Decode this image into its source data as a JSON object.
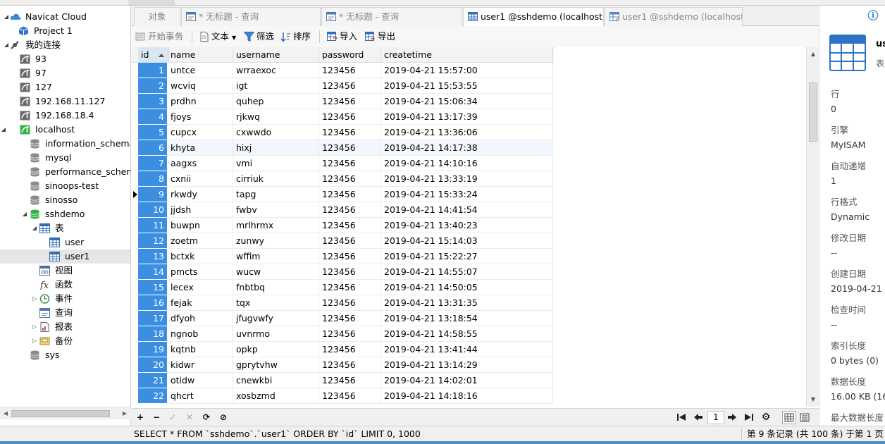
{
  "sidebar": {
    "items": [
      {
        "label": "Navicat Cloud",
        "icon": "cloud-icon",
        "arrow": "expanded"
      },
      {
        "label": "Project 1",
        "icon": "project-cube-icon",
        "arrow": ""
      },
      {
        "label": "我的连接",
        "icon": "connections-icon",
        "arrow": "expanded"
      },
      {
        "label": "93",
        "icon": "dolphin-connection-icon",
        "arrow": ""
      },
      {
        "label": "97",
        "icon": "dolphin-connection-icon",
        "arrow": ""
      },
      {
        "label": "127",
        "icon": "dolphin-connection-icon",
        "arrow": ""
      },
      {
        "label": "192.168.11.127",
        "icon": "dolphin-connection-icon",
        "arrow": ""
      },
      {
        "label": "192.168.18.4",
        "icon": "dolphin-connection-icon",
        "arrow": ""
      },
      {
        "label": "localhost",
        "icon": "dolphin-connection-active-icon",
        "arrow": "expanded"
      },
      {
        "label": "information_schema",
        "icon": "database-icon",
        "arrow": ""
      },
      {
        "label": "mysql",
        "icon": "database-icon",
        "arrow": ""
      },
      {
        "label": "performance_schema",
        "icon": "database-icon",
        "arrow": ""
      },
      {
        "label": "sinoops-test",
        "icon": "database-icon",
        "arrow": ""
      },
      {
        "label": "sinosso",
        "icon": "database-icon",
        "arrow": ""
      },
      {
        "label": "sshdemo",
        "icon": "database-open-icon",
        "arrow": "expanded"
      },
      {
        "label": "表",
        "icon": "tables-icon",
        "arrow": "expanded"
      },
      {
        "label": "user",
        "icon": "table-icon",
        "arrow": ""
      },
      {
        "label": "user1",
        "icon": "table-icon",
        "arrow": "",
        "selected": true
      },
      {
        "label": "视图",
        "icon": "view-icon",
        "arrow": ""
      },
      {
        "label": "函数",
        "icon": "function-icon",
        "arrow": ""
      },
      {
        "label": "事件",
        "icon": "event-clock-icon",
        "arrow": "collapsed"
      },
      {
        "label": "查询",
        "icon": "query-icon",
        "arrow": ""
      },
      {
        "label": "报表",
        "icon": "report-icon",
        "arrow": "collapsed"
      },
      {
        "label": "备份",
        "icon": "backup-icon",
        "arrow": "collapsed"
      },
      {
        "label": "sys",
        "icon": "database-icon",
        "arrow": ""
      }
    ]
  },
  "tabs": [
    {
      "label": "对象",
      "icon": ""
    },
    {
      "label": "* 无标题 - 查询",
      "icon": "query-tab-icon"
    },
    {
      "label": "* 无标题 - 查询",
      "icon": "query-tab-icon"
    },
    {
      "label": "user1 @sshdemo (localhost...",
      "icon": "table-tab-icon",
      "active": true
    },
    {
      "label": "user1 @sshdemo (localhost...",
      "icon": "table-design-tab-icon"
    }
  ],
  "toolbar": {
    "begin_transaction": "开始事务",
    "text": "文本",
    "filter": "筛选",
    "sort": "排序",
    "import": "导入",
    "export": "导出"
  },
  "grid": {
    "columns": [
      "id",
      "name",
      "username",
      "password",
      "createtime"
    ],
    "current_row": 9,
    "rows": [
      [
        "1",
        "untce",
        "wrraexoc",
        "123456",
        "2019-04-21 15:57:00"
      ],
      [
        "2",
        "wcviq",
        "igt",
        "123456",
        "2019-04-21 15:53:55"
      ],
      [
        "3",
        "prdhn",
        "quhep",
        "123456",
        "2019-04-21 15:06:34"
      ],
      [
        "4",
        "fjoys",
        "rjkwq",
        "123456",
        "2019-04-21 13:17:39"
      ],
      [
        "5",
        "cupcx",
        "cxwwdo",
        "123456",
        "2019-04-21 13:36:06"
      ],
      [
        "6",
        "khyta",
        "hixj",
        "123456",
        "2019-04-21 14:17:38"
      ],
      [
        "7",
        "aagxs",
        "vmi",
        "123456",
        "2019-04-21 14:10:16"
      ],
      [
        "8",
        "cxnii",
        "cirriuk",
        "123456",
        "2019-04-21 13:33:19"
      ],
      [
        "9",
        "rkwdy",
        "tapg",
        "123456",
        "2019-04-21 15:33:24"
      ],
      [
        "10",
        "jjdsh",
        "fwbv",
        "123456",
        "2019-04-21 14:41:54"
      ],
      [
        "11",
        "buwpn",
        "mrlhrmx",
        "123456",
        "2019-04-21 13:40:23"
      ],
      [
        "12",
        "zoetm",
        "zunwy",
        "123456",
        "2019-04-21 15:14:03"
      ],
      [
        "13",
        "bctxk",
        "wffim",
        "123456",
        "2019-04-21 15:22:27"
      ],
      [
        "14",
        "pmcts",
        "wucw",
        "123456",
        "2019-04-21 14:55:07"
      ],
      [
        "15",
        "lecex",
        "fnbtbq",
        "123456",
        "2019-04-21 14:50:05"
      ],
      [
        "16",
        "fejak",
        "tqx",
        "123456",
        "2019-04-21 13:31:35"
      ],
      [
        "17",
        "dfyoh",
        "jfugvwfy",
        "123456",
        "2019-04-21 13:18:54"
      ],
      [
        "18",
        "ngnob",
        "uvnrmo",
        "123456",
        "2019-04-21 14:58:55"
      ],
      [
        "19",
        "kqtnb",
        "opkp",
        "123456",
        "2019-04-21 13:41:44"
      ],
      [
        "20",
        "kidwr",
        "gprytvhw",
        "123456",
        "2019-04-21 13:14:29"
      ],
      [
        "21",
        "otidw",
        "cnewkbi",
        "123456",
        "2019-04-21 14:02:01"
      ],
      [
        "22",
        "qhcrt",
        "xosbzmd",
        "123456",
        "2019-04-21 14:18:16"
      ]
    ]
  },
  "navbar": {
    "add": "+",
    "remove": "−",
    "apply": "✓",
    "discard": "✕",
    "refresh": "⟳",
    "stop": "⊘",
    "page": "1"
  },
  "status": {
    "sql": "SELECT * FROM `sshdemo`.`user1` ORDER BY `id` LIMIT 0, 1000",
    "record_info": "第 9 条记录 (共 100 条) 于第 1 页"
  },
  "info_panel": {
    "name": "us",
    "type": "表",
    "props": [
      {
        "key": "行",
        "value": "0"
      },
      {
        "key": "引擎",
        "value": "MyISAM"
      },
      {
        "key": "自动递增",
        "value": "1"
      },
      {
        "key": "行格式",
        "value": "Dynamic"
      },
      {
        "key": "修改日期",
        "value": "--"
      },
      {
        "key": "创建日期",
        "value": "2019-04-21 14"
      },
      {
        "key": "检查时间",
        "value": "--"
      },
      {
        "key": "索引长度",
        "value": "0 bytes (0)"
      },
      {
        "key": "数据长度",
        "value": "16.00 KB (16,3"
      },
      {
        "key": "最大数据长度",
        "value": ""
      }
    ]
  },
  "colors": {
    "id_cell_bg": "#3c8fe0",
    "accent": "#1f6fd2"
  }
}
